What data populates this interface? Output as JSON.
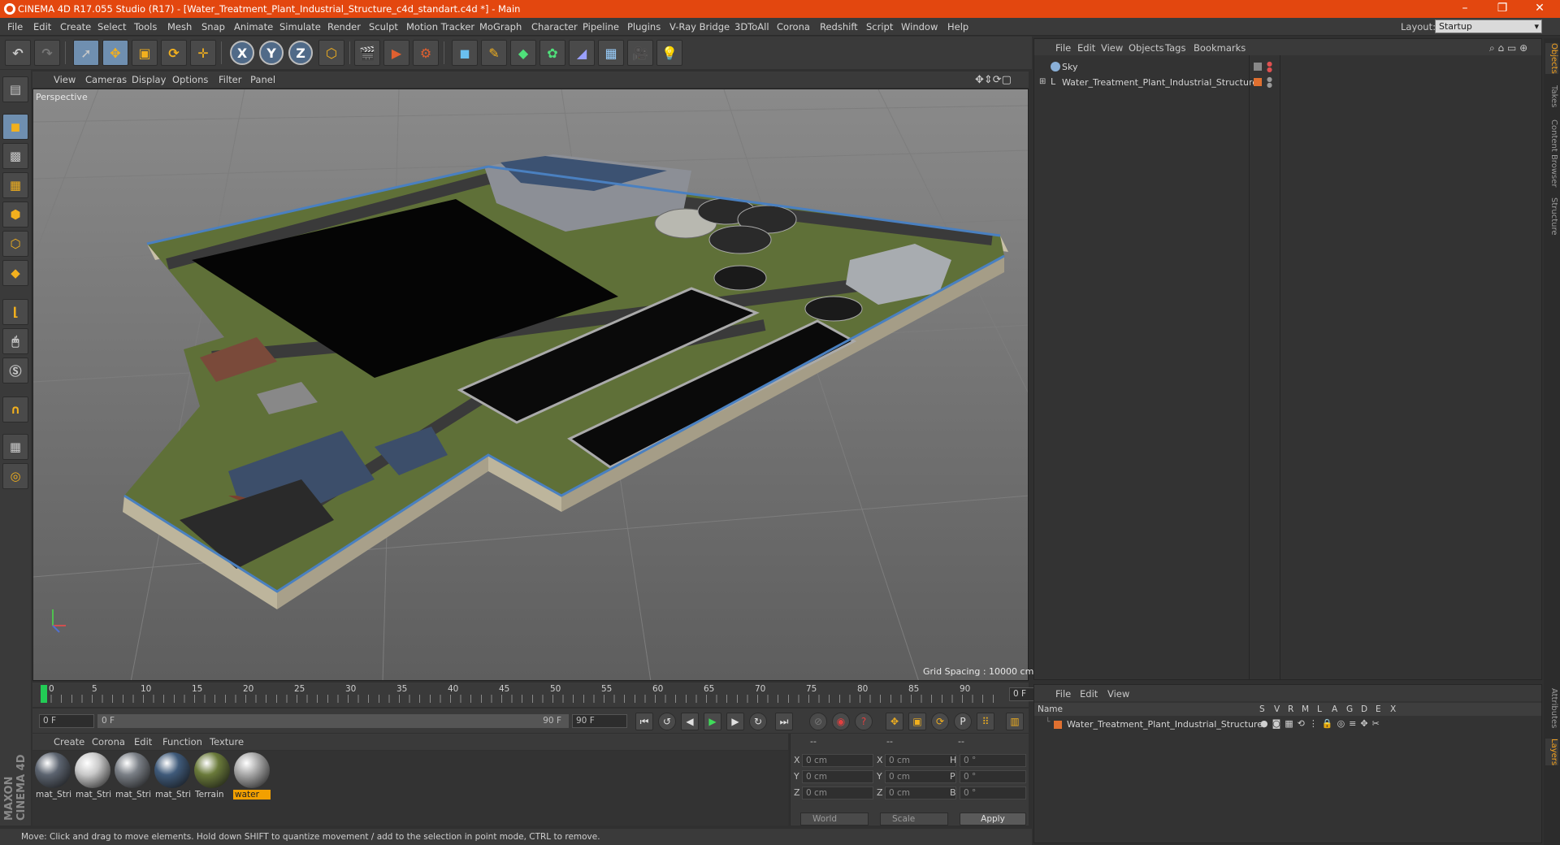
{
  "window": {
    "title": "CINEMA 4D R17.055 Studio (R17) - [Water_Treatment_Plant_Industrial_Structure_c4d_standart.c4d *] - Main"
  },
  "menu": [
    "File",
    "Edit",
    "Create",
    "Select",
    "Tools",
    "Mesh",
    "Snap",
    "Animate",
    "Simulate",
    "Render",
    "Sculpt",
    "Motion Tracker",
    "MoGraph",
    "Character",
    "Pipeline",
    "Plugins",
    "V-Ray Bridge",
    "3DToAll",
    "Corona",
    "Redshift",
    "Script",
    "Window",
    "Help"
  ],
  "layout": {
    "label": "Layout:",
    "value": "Startup"
  },
  "viewport": {
    "menu": [
      "View",
      "Cameras",
      "Display",
      "Options",
      "Filter",
      "Panel"
    ],
    "camera": "Perspective",
    "grid_spacing": "Grid Spacing : 10000 cm"
  },
  "timeline": {
    "ticks": [
      "0",
      "5",
      "10",
      "15",
      "20",
      "25",
      "30",
      "35",
      "40",
      "45",
      "50",
      "55",
      "60",
      "65",
      "70",
      "75",
      "80",
      "85",
      "90"
    ],
    "end_frame": "0 F",
    "start_field": "0 F",
    "range_start": "0 F",
    "range_end": "90 F",
    "max_field": "90 F"
  },
  "materials": {
    "menu": [
      "Create",
      "Corona",
      "Edit",
      "Function",
      "Texture"
    ],
    "items": [
      {
        "label": "mat_Stri",
        "color": "#5c6470"
      },
      {
        "label": "mat_Stri",
        "color": "#c9c9c9"
      },
      {
        "label": "mat_Stri",
        "color": "#7a7f86"
      },
      {
        "label": "mat_Stri",
        "color": "#3f5a7a"
      },
      {
        "label": "Terrain",
        "color": "#6a7a3a"
      },
      {
        "label": "water",
        "color": "#a8a8a8"
      }
    ]
  },
  "coords": {
    "headers": [
      "--",
      "--",
      "--"
    ],
    "rows": [
      {
        "a": "X",
        "av": "0 cm",
        "b": "X",
        "bv": "0 cm",
        "c": "H",
        "cv": "0 °"
      },
      {
        "a": "Y",
        "av": "0 cm",
        "b": "Y",
        "bv": "0 cm",
        "c": "P",
        "cv": "0 °"
      },
      {
        "a": "Z",
        "av": "0 cm",
        "b": "Z",
        "bv": "0 cm",
        "c": "B",
        "cv": "0 °"
      }
    ],
    "space": "World",
    "mode": "Scale",
    "apply": "Apply"
  },
  "status": "Move: Click and drag to move elements. Hold down SHIFT to quantize movement / add to the selection in point mode, CTRL to remove.",
  "object_manager": {
    "menu": [
      "File",
      "Edit",
      "View",
      "Objects",
      "Tags",
      "Bookmarks"
    ],
    "objects": [
      "Sky",
      "Water_Treatment_Plant_Industrial_Structure"
    ]
  },
  "layer_manager": {
    "menu": [
      "File",
      "Edit",
      "View"
    ],
    "name_header": "Name",
    "columns": [
      "S",
      "V",
      "R",
      "M",
      "L",
      "A",
      "G",
      "D",
      "E",
      "X"
    ],
    "layers": [
      "Water_Treatment_Plant_Industrial_Structure"
    ]
  },
  "right_tabs": [
    "Objects",
    "Takes",
    "Content Browser",
    "Structure"
  ],
  "right_tabs_lower": [
    "Attributes",
    "Layers"
  ],
  "maxon_brand": "MAXON CINEMA 4D"
}
